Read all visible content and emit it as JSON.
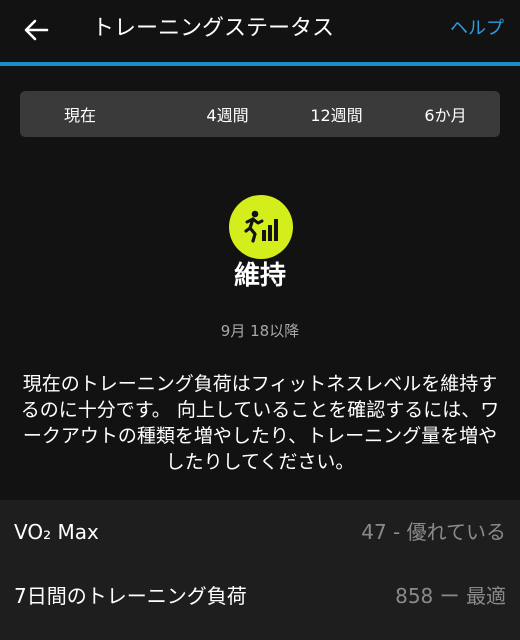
{
  "header": {
    "title": "トレーニングステータス",
    "help_label": "ヘルプ",
    "back_icon": "arrow-left-icon"
  },
  "tabs": [
    {
      "label": "現在",
      "selected": true
    },
    {
      "label": "4週間",
      "selected": false
    },
    {
      "label": "12週間",
      "selected": false
    },
    {
      "label": "6か月",
      "selected": false
    }
  ],
  "status": {
    "icon": "training-maintaining-icon",
    "icon_color": "#d4ee1c",
    "label": "維持",
    "since": "9月 18以降",
    "description": "現在のトレーニング負荷はフィットネスレベルを維持するのに十分です。 向上していることを確認するには、ワークアウトの種類を増やしたり、トレーニング量を増やしたりしてください。"
  },
  "metrics": [
    {
      "label": "VO₂ Max",
      "value": "47 - 優れている"
    },
    {
      "label": "7日間のトレーニング負荷",
      "value": "858 ー 最適"
    }
  ],
  "colors": {
    "accent": "#1a8ed0",
    "link": "#2c9ddc",
    "background": "#121212"
  }
}
